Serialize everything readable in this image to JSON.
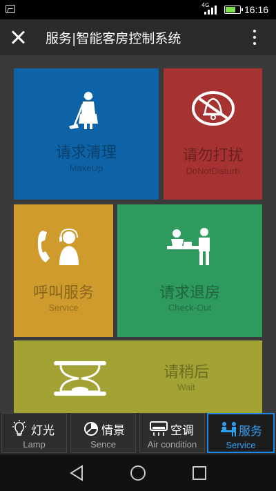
{
  "status_bar": {
    "network": "4G",
    "time": "16:16"
  },
  "app_bar": {
    "title": "服务|智能客房控制系统"
  },
  "tiles": {
    "makeup": {
      "cn": "请求清理",
      "en": "MakeUp",
      "color": "#0d63a6",
      "icon": "cleaning-person-icon"
    },
    "dnd": {
      "cn": "请勿打扰",
      "en": "DoNotDisturb",
      "color": "#a63232",
      "icon": "no-bell-icon"
    },
    "service": {
      "cn": "呼叫服务",
      "en": "Service",
      "color": "#cf9b2d",
      "icon": "phone-attendant-icon"
    },
    "checkout": {
      "cn": "请求退房",
      "en": "Check-Out",
      "color": "#2e9a5e",
      "icon": "reception-desk-icon"
    },
    "wait": {
      "cn": "请稍后",
      "en": "Wait",
      "color": "#a3a335",
      "icon": "hourglass-icon"
    }
  },
  "bottom_nav": {
    "items": [
      {
        "cn": "灯光",
        "en": "Lamp",
        "icon": "lightbulb-icon"
      },
      {
        "cn": "情景",
        "en": "Sence",
        "icon": "pie-chart-icon"
      },
      {
        "cn": "空调",
        "en": "Air condition",
        "icon": "air-conditioner-icon"
      },
      {
        "cn": "服务",
        "en": "Service",
        "icon": "service-people-icon"
      }
    ],
    "active_index": 3,
    "active_color": "#2f9df0"
  }
}
